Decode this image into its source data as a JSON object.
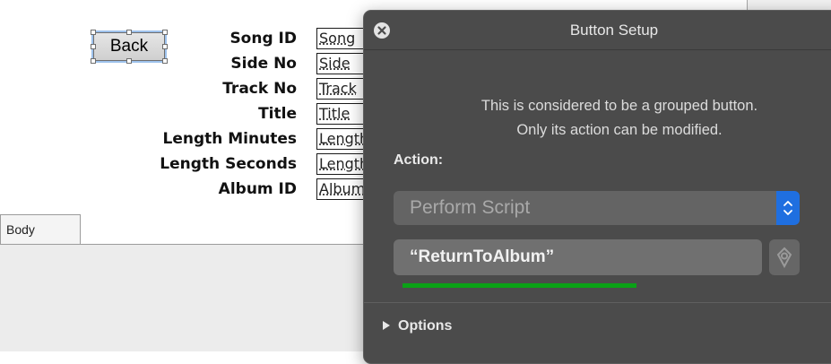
{
  "layout": {
    "back_button_label": "Back",
    "fields": [
      {
        "label": "Song ID",
        "value": "Song"
      },
      {
        "label": "Side No",
        "value": "Side"
      },
      {
        "label": "Track No",
        "value": "Track"
      },
      {
        "label": "Title",
        "value": "Title"
      },
      {
        "label": "Length Minutes",
        "value": "Length"
      },
      {
        "label": "Length Seconds",
        "value": "Length"
      },
      {
        "label": "Album ID",
        "value": "Album"
      }
    ],
    "part_label": "Body"
  },
  "dialog": {
    "title": "Button Setup",
    "note_line1": "This is considered to be a grouped button.",
    "note_line2": "Only its action can be modified.",
    "action_label": "Action:",
    "action_value": "Perform Script",
    "script_value": "“ReturnToAlbum”",
    "options_label": "Options",
    "progress": 1.0,
    "colors": {
      "panel": "#4b4b4b",
      "accent": "#1f6fe0",
      "progress": "#0aa116"
    }
  }
}
